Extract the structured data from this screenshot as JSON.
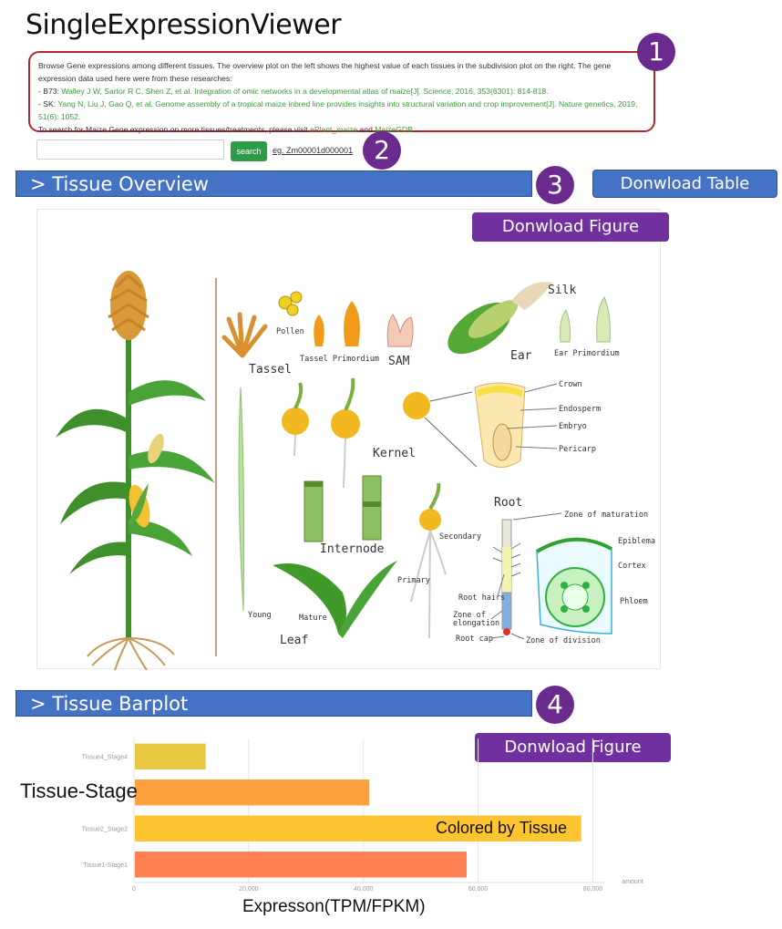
{
  "app": {
    "title": "SingleExpressionViewer"
  },
  "description": {
    "line1": "Browse Gene expressions among different tissues. The overview plot on the left shows the highest value of each tissues in the subdivision plot on the right. The gene",
    "line2": "expression data used here were from these researches:",
    "b73_prefix": "- B73: ",
    "b73_ref": "Walley J W, Sartor R C, Shen Z, et al. Integration of omic networks in a developmental atlas of maize[J]. Science, 2016, 353(6301): 814-818.",
    "sk_prefix": "- SK: ",
    "sk_ref_1": "Yang N, Liu J, Gao Q, et al. Genome assembly of a tropical maize inbred line provides insights into structural variation and crop improvement[J]. Nature genetics, 2019,",
    "sk_ref_2": "51(6): 1052.",
    "visit_prefix": "To search for Maize Gene expression on more tissues/treatments, please visit ",
    "link_eplant": "ePlant_maize",
    "and": " and ",
    "link_maizegdb": "MaizeGDB",
    "period": "."
  },
  "search": {
    "placeholder": "",
    "button_label": "search",
    "example": "eg. Zm00001d000001"
  },
  "badges": [
    "1",
    "2",
    "3",
    "4"
  ],
  "overview": {
    "section_title": "> Tissue Overview",
    "download_table": "Donwload Table",
    "download_figure": "Donwload Figure",
    "labels": {
      "pollen": "Pollen",
      "tassel": "Tassel",
      "tassel_primordium": "Tassel Primordium",
      "sam": "SAM",
      "silk": "Silk",
      "ear": "Ear",
      "ear_primordium": "Ear Primordium",
      "crown": "Crown",
      "endosperm": "Endosperm",
      "embryo": "Embryo",
      "pericarp": "Pericarp",
      "kernel": "Kernel",
      "internode": "Internode",
      "root": "Root",
      "secondary": "Secondary",
      "primary": "Primary",
      "zone_maturation": "Zone of maturation",
      "epiblema": "Epiblema",
      "cortex": "Cortex",
      "phloem": "Phloem",
      "root_hairs": "Root hairs",
      "zone_of": "Zone of",
      "elongation": "elongation",
      "root_cap": "Root cap",
      "zone_division": "Zone of division",
      "young": "Young",
      "mature": "Mature",
      "leaf": "Leaf"
    }
  },
  "barplot": {
    "section_title": "> Tissue Barplot",
    "download_figure": "Donwload Figure",
    "annotation_y": "Tissue-Stage",
    "annotation_color": "Colored by Tissue",
    "annotation_x": "Expresson(TPM/FPKM)"
  },
  "chart_data": {
    "type": "bar",
    "orientation": "horizontal",
    "categories": [
      "Tissue1-Stage1",
      "Tissue2_Stage2",
      "",
      "Tissue4_Stage4"
    ],
    "values": [
      58000,
      78000,
      41000,
      12500
    ],
    "colors": [
      "#ff8052",
      "#ffc530",
      "#ffa040",
      "#e8c840"
    ],
    "xlabel": "amount",
    "xlim": [
      0,
      82000
    ],
    "xticks": [
      0,
      20000,
      40000,
      60000,
      80000
    ],
    "xtick_labels": [
      "0",
      "20,000",
      "40,000",
      "60,000",
      "80,000"
    ],
    "grid": true
  }
}
